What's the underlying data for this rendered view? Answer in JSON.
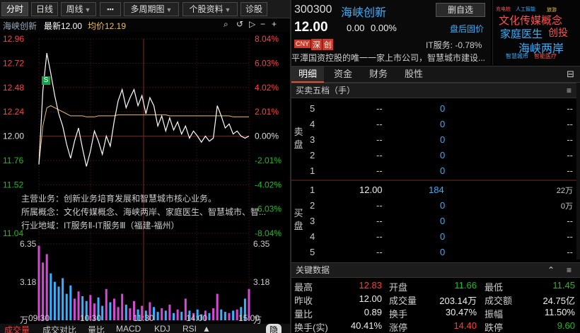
{
  "toolbar": {
    "fenshi": "分时",
    "rixian": "日线",
    "zhouxian": "周线",
    "more": "▪▪▪",
    "multi_period": "多周期图",
    "stock_info": "个股资料",
    "diagnose": "诊股"
  },
  "chart": {
    "name": "海峡创新",
    "latest_label": "最新12.00",
    "avg_label": "均价12.19",
    "price_ticks": [
      "12.96",
      "12.72",
      "12.48",
      "12.24",
      "12.00",
      "11.76",
      "11.52",
      "11.04"
    ],
    "pct_ticks": [
      "8.04%",
      "6.03%",
      "4.02%",
      "2.01%",
      "0.00%",
      "-2.01%",
      "-4.02%",
      "-6.03%",
      "-8.04%"
    ],
    "vol_ticks_left": [
      "6.35",
      "3.18",
      "万"
    ],
    "vol_ticks_right": [
      "6.35",
      "3.18",
      "万"
    ],
    "time_ticks": [
      "09:30",
      "10:30",
      "11:30",
      "14:00",
      "15:00"
    ],
    "s_marker": "S",
    "info_lines": [
      "主营业务：创新业务培育发展和智慧城市核心业务。",
      "所属概念：文化传媒概念、海峡两岸、家庭医生、智慧城市、智...",
      "行业地域：IT服务Ⅱ-IT服务Ⅲ（福建-福州）"
    ],
    "bottom_tabs": [
      "成交量",
      "成交对比",
      "量比",
      "MACD",
      "KDJ",
      "RSI"
    ],
    "bottom_more": "▲",
    "bottom_right": "隐"
  },
  "stock": {
    "code": "300300",
    "name": "海峡创新",
    "remove_btn": "删自选",
    "price": "12.00",
    "change": "0.00",
    "change_pct": "0.00%",
    "after_hours": "盘后固价",
    "badges": [
      "CNY",
      "深",
      "创"
    ],
    "industry": "IT服务: -0.78%",
    "desc": "平潭国资控股的唯一一家上市公司，智慧城市建设..."
  },
  "banner": {
    "words": [
      "文化传媒概念",
      "家庭医生",
      "创投",
      "海峡两岸",
      "智慧城市",
      "智能医疗",
      "充电桩",
      "人工智能",
      "旅游"
    ]
  },
  "tabs": [
    "明细",
    "资金",
    "财务",
    "股性"
  ],
  "orderbook": {
    "title": "买卖五档（手）",
    "sell_label": "卖盘",
    "buy_label": "买盘",
    "sell": [
      {
        "lvl": "5",
        "price": "--",
        "vol": "0",
        "amt": "--"
      },
      {
        "lvl": "4",
        "price": "--",
        "vol": "0",
        "amt": "--"
      },
      {
        "lvl": "3",
        "price": "--",
        "vol": "0",
        "amt": "--"
      },
      {
        "lvl": "2",
        "price": "--",
        "vol": "0",
        "amt": "--"
      },
      {
        "lvl": "1",
        "price": "--",
        "vol": "0",
        "amt": "--"
      }
    ],
    "buy": [
      {
        "lvl": "1",
        "price": "12.00",
        "vol": "184",
        "amt": "22万"
      },
      {
        "lvl": "2",
        "price": "--",
        "vol": "0",
        "amt": "0万"
      },
      {
        "lvl": "3",
        "price": "--",
        "vol": "0",
        "amt": "--"
      },
      {
        "lvl": "4",
        "price": "--",
        "vol": "0",
        "amt": "--"
      },
      {
        "lvl": "5",
        "price": "--",
        "vol": "0",
        "amt": "--"
      }
    ]
  },
  "keydata": {
    "title": "关键数据",
    "rows": [
      [
        {
          "k": "最高",
          "v": "12.83",
          "c": "red"
        },
        {
          "k": "开盘",
          "v": "11.66",
          "c": "green"
        },
        {
          "k": "最低",
          "v": "11.45",
          "c": "green"
        }
      ],
      [
        {
          "k": "昨收",
          "v": "12.00",
          "c": "white"
        },
        {
          "k": "成交量",
          "v": "203.14万",
          "c": "white"
        },
        {
          "k": "成交额",
          "v": "24.75亿",
          "c": "white"
        }
      ],
      [
        {
          "k": "量比",
          "v": "0.89",
          "c": "white"
        },
        {
          "k": "换手",
          "v": "30.47%",
          "c": "white"
        },
        {
          "k": "振幅",
          "v": "11.50%",
          "c": "white"
        }
      ],
      [
        {
          "k": "换手(实)",
          "v": "40.41%",
          "c": "white"
        },
        {
          "k": "涨停",
          "v": "14.40",
          "c": "red"
        },
        {
          "k": "跌停",
          "v": "9.60",
          "c": "green"
        }
      ]
    ]
  },
  "chart_data": {
    "type": "line",
    "prev_close": 12.0,
    "ylim": [
      11.04,
      12.96
    ],
    "series": [
      {
        "values": [
          11.72,
          12.45,
          12.82,
          12.62,
          12.4,
          12.22,
          12.1,
          11.92,
          11.78,
          11.95,
          12.08,
          11.88,
          11.7,
          11.85,
          12.05,
          11.95,
          11.82,
          12.0,
          11.9,
          12.15,
          12.35,
          12.46,
          12.28,
          12.38,
          12.46,
          12.3,
          12.4,
          12.22,
          12.38,
          12.3,
          12.1,
          12.2,
          12.05,
          12.18,
          12.06,
          12.14,
          12.02,
          12.1,
          11.98,
          12.05,
          12.0,
          11.94,
          12.0,
          11.95,
          11.98,
          12.3,
          12.2,
          12.08,
          12.12,
          12.02,
          12.05,
          12.0,
          11.98,
          12.0
        ]
      },
      {
        "values": [
          11.72,
          12.1,
          12.28,
          12.3,
          12.28,
          12.26,
          12.24,
          12.22,
          12.2,
          12.2,
          12.2,
          12.2,
          12.19,
          12.19,
          12.19,
          12.2,
          12.2,
          12.2,
          12.2,
          12.2,
          12.21,
          12.21,
          12.21,
          12.21,
          12.21,
          12.21,
          12.21,
          12.21,
          12.21,
          12.21,
          12.21,
          12.21,
          12.21,
          12.2,
          12.2,
          12.2,
          12.2,
          12.2,
          12.2,
          12.2,
          12.2,
          12.2,
          12.2,
          12.2,
          12.2,
          12.2,
          12.2,
          12.2,
          12.2,
          12.19,
          12.19,
          12.19,
          12.19,
          12.19
        ]
      }
    ],
    "volume": [
      6.2,
      4.8,
      5.5,
      3.9,
      3.2,
      2.8,
      3.5,
      2.2,
      2.9,
      1.8,
      2.4,
      2.0,
      1.6,
      2.1,
      1.4,
      1.9,
      1.2,
      2.6,
      1.5,
      1.8,
      1.1,
      2.2,
      1.3,
      1.0,
      1.6,
      0.9,
      1.2,
      0.8,
      1.5,
      1.1,
      0.7,
      1.0,
      0.8,
      1.3,
      0.6,
      0.9,
      0.7,
      1.8,
      0.8,
      0.6,
      0.9,
      0.5,
      0.8,
      0.6,
      1.0,
      2.2,
      0.9,
      0.7,
      0.6,
      0.8,
      0.9,
      1.1,
      1.8,
      2.6
    ]
  }
}
